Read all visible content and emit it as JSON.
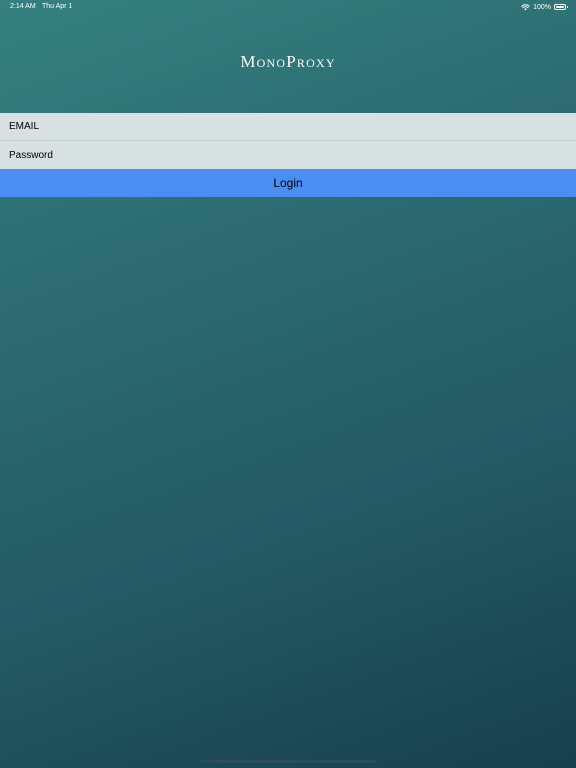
{
  "status_bar": {
    "time": "2:14 AM",
    "date": "Thu Apr 1",
    "battery_percent_label": "100%",
    "battery_level": 1.0,
    "wifi_icon": "wifi-icon",
    "battery_icon": "battery-icon"
  },
  "app": {
    "title": "MonoProxy"
  },
  "login_form": {
    "email_placeholder": "EMAIL",
    "password_placeholder": "Password",
    "login_label": "Login"
  },
  "colors": {
    "background_top": "#34807f",
    "background_bottom": "#173f4d",
    "field_background": "#d7e1e2",
    "button_background": "#4a8ef3"
  }
}
